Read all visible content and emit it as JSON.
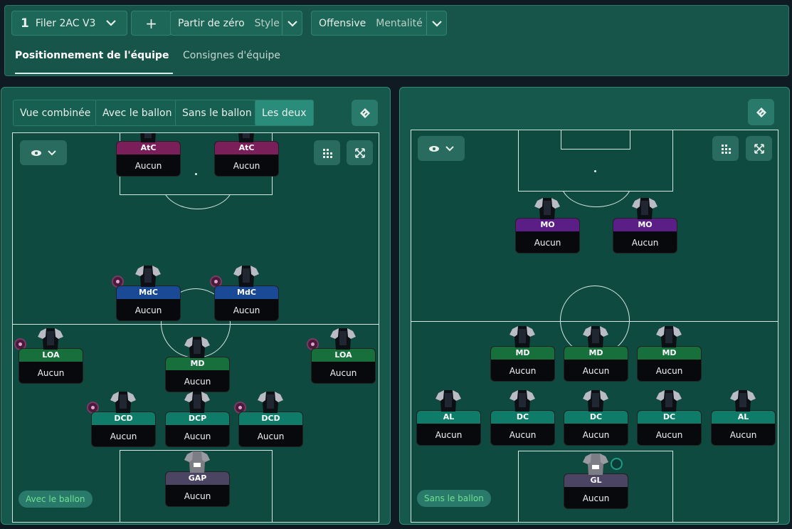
{
  "toolbar": {
    "tactic_number": "1",
    "tactic_name": "Filer 2AC V3",
    "add_label": "+",
    "style_value": "Partir de zéro",
    "style_label": "Style",
    "mentality_value": "Offensive",
    "mentality_label": "Mentalité"
  },
  "tabs": [
    {
      "label": "Positionnement de l'équipe",
      "active": true
    },
    {
      "label": "Consignes d'équipe",
      "active": false
    }
  ],
  "view_buttons": [
    {
      "label": "Vue combinée",
      "active": false
    },
    {
      "label": "Avec le ballon",
      "active": false
    },
    {
      "label": "Sans le ballon",
      "active": false
    },
    {
      "label": "Les deux",
      "active": true
    }
  ],
  "left_pitch": {
    "mode_badge": "Avec le ballon",
    "players": [
      {
        "pos": "AtC",
        "role": "Aucun",
        "color": "#7b1f5a"
      },
      {
        "pos": "AtC",
        "role": "Aucun",
        "color": "#7b1f5a"
      },
      {
        "pos": "MdC",
        "role": "Aucun",
        "color": "#1a4a96"
      },
      {
        "pos": "MdC",
        "role": "Aucun",
        "color": "#1a4a96"
      },
      {
        "pos": "LOA",
        "role": "Aucun",
        "color": "#176f3b"
      },
      {
        "pos": "MD",
        "role": "Aucun",
        "color": "#176f3b"
      },
      {
        "pos": "LOA",
        "role": "Aucun",
        "color": "#176f3b"
      },
      {
        "pos": "DCD",
        "role": "Aucun",
        "color": "#0f7c69"
      },
      {
        "pos": "DCP",
        "role": "Aucun",
        "color": "#0f7c69"
      },
      {
        "pos": "DCD",
        "role": "Aucun",
        "color": "#0f7c69"
      },
      {
        "pos": "GAP",
        "role": "Aucun",
        "color": "#4c4463"
      }
    ]
  },
  "right_pitch": {
    "mode_badge": "Sans le ballon",
    "players": [
      {
        "pos": "MO",
        "role": "Aucun",
        "color": "#5b1e86"
      },
      {
        "pos": "MO",
        "role": "Aucun",
        "color": "#5b1e86"
      },
      {
        "pos": "MD",
        "role": "Aucun",
        "color": "#176f3b"
      },
      {
        "pos": "MD",
        "role": "Aucun",
        "color": "#176f3b"
      },
      {
        "pos": "MD",
        "role": "Aucun",
        "color": "#176f3b"
      },
      {
        "pos": "AL",
        "role": "Aucun",
        "color": "#0f7c69"
      },
      {
        "pos": "DC",
        "role": "Aucun",
        "color": "#0f7c69"
      },
      {
        "pos": "DC",
        "role": "Aucun",
        "color": "#0f7c69"
      },
      {
        "pos": "DC",
        "role": "Aucun",
        "color": "#0f7c69"
      },
      {
        "pos": "AL",
        "role": "Aucun",
        "color": "#0f7c69"
      },
      {
        "pos": "GL",
        "role": "Aucun",
        "color": "#4c4463"
      }
    ]
  },
  "icons": [
    "chevron-down-icon",
    "plus-icon",
    "eye-icon",
    "grid-icon",
    "expand-icon",
    "swap-icon",
    "shirt-icon"
  ]
}
